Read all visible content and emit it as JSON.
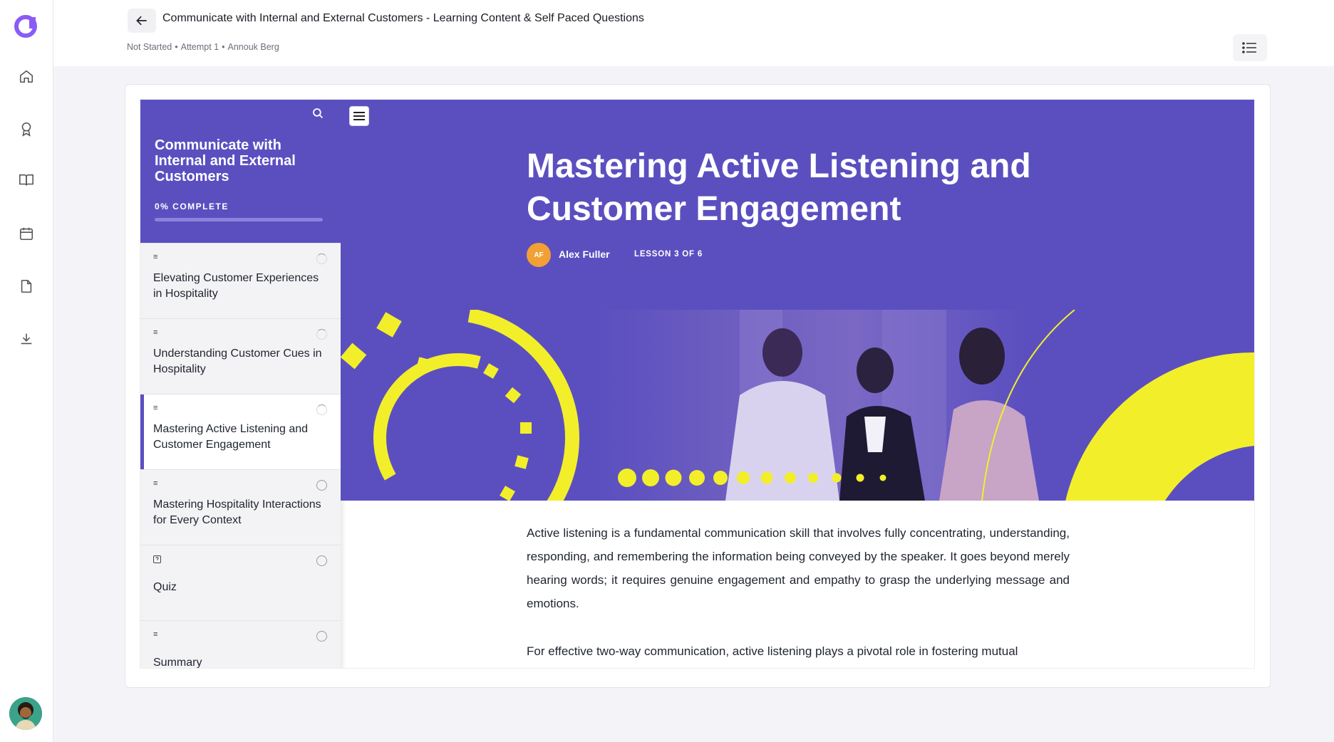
{
  "header": {
    "title": "Communicate with Internal and External Customers - Learning Content & Self Paced Questions",
    "status": "Not Started",
    "attempt": "Attempt 1",
    "learner": "Annouk Berg",
    "separator": "•"
  },
  "rail": {
    "icons": [
      "logo-icon",
      "home-icon",
      "award-icon",
      "book-icon",
      "calendar-icon",
      "document-icon",
      "download-icon"
    ]
  },
  "course": {
    "title": "Communicate with Internal and External Customers",
    "progress_label": "0% COMPLETE",
    "progress": 0,
    "lessons": [
      {
        "label": "Elevating Customer Experiences in Hospitality",
        "type": "lesson-icon",
        "status": "in-progress"
      },
      {
        "label": "Understanding Customer Cues in Hospitality",
        "type": "lesson-icon",
        "status": "in-progress"
      },
      {
        "label": "Mastering Active Listening and Customer Engagement",
        "type": "lesson-icon",
        "status": "in-progress"
      },
      {
        "label": "Mastering Hospitality Interactions for Every Context",
        "type": "lesson-icon",
        "status": "not-started"
      },
      {
        "label": "Quiz",
        "type": "quiz-icon",
        "status": "not-started"
      },
      {
        "label": "Summary",
        "type": "lesson-icon",
        "status": "not-started"
      }
    ]
  },
  "lesson": {
    "title": "Mastering Active Listening and Customer Engagement",
    "author_initials": "AF",
    "author": "Alex Fuller",
    "count": "LESSON 3 OF 6",
    "paragraphs": [
      "Active listening is a fundamental communication skill that involves fully concentrating, understanding, responding, and remembering the information being conveyed by the speaker. It goes beyond merely hearing words; it requires genuine engagement and empathy to grasp the underlying message and emotions.",
      "For effective two-way communication, active listening plays a pivotal role in fostering mutual"
    ]
  },
  "colors": {
    "brand": "#5b4fc0",
    "accent_yellow": "#f2ef2a",
    "avatar_orange": "#f2a033"
  }
}
